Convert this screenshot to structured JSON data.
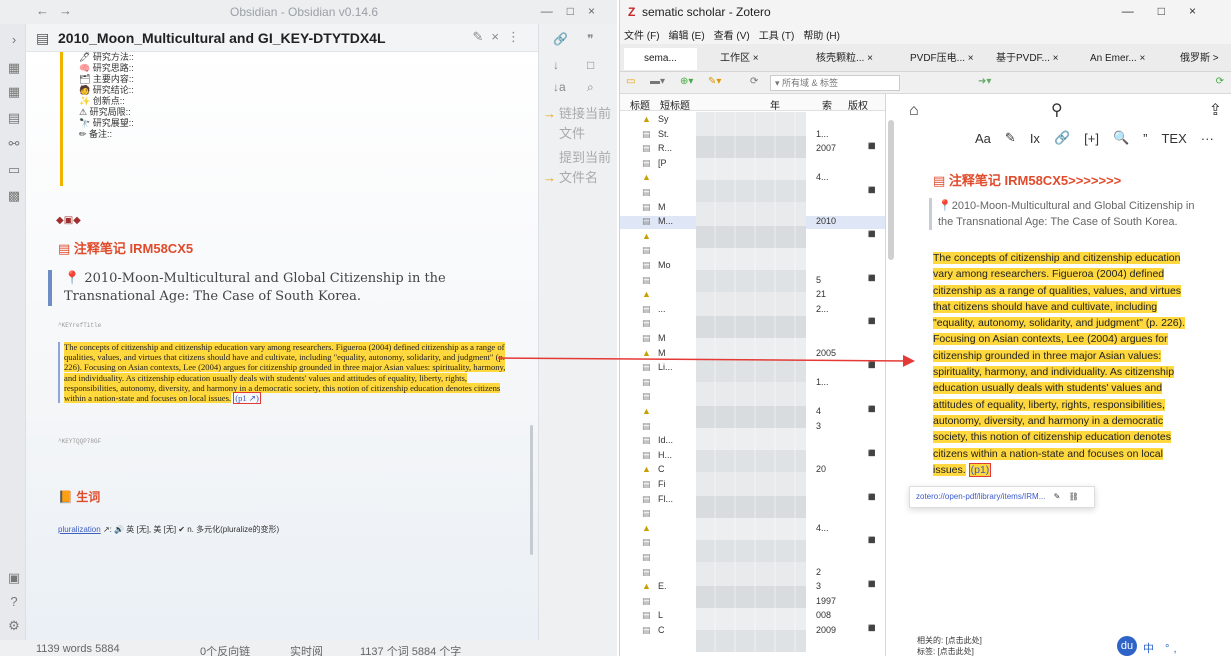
{
  "obsidian": {
    "window_title": "Obsidian - Obsidian v0.14.6",
    "tab_title": "2010_Moon_Multicultural and GI_KEY-DTYTDX4L",
    "outline_items": [
      "🖊 研究方法::",
      "🧠 研究思路::",
      "🗂 主要内容::",
      "🧑 研究结论::",
      "✨ 创新点::",
      "⚠ 研究局限::",
      "🔭 研究展望::",
      "✏ 备注::"
    ],
    "decor_text": "◆▣◆",
    "note_heading": "注释笔记 IRM58CX5",
    "citation": "2010-Moon-Multicultural and Global Citizenship in the Transnational Age: The Case of South Korea.",
    "key_tag_1": "^KEYrefTitle",
    "quote_text": "The concepts of citizenship and citizenship education vary among researchers. Figueroa (2004) defined citizenship as a range of qualities, values, and virtues that citizens should have and cultivate, including \"equality, autonomy, solidarity, and judgment\" (p. 226). Focusing on Asian contexts, Lee (2004) argues for citizenship grounded in three major Asian values: spirituality, harmony, and individuality. As citizenship education usually deals with students' values and attitudes of equality, liberty, rights, responsibilities, autonomy, diversity, and harmony in a democratic society, this notion of citizenship education denotes citizens within a nation-state and focuses on local issues.",
    "page_link": "(p1 ↗)",
    "key_tag_2": "^KEYTQQP78GF",
    "vocab_heading": "生词",
    "vocab_word": "pluralization",
    "vocab_rest": "↗: 🔊 英 [无], 美 [无] ✔ n. 多元化(pluralize的变形)",
    "side_panel": [
      "链接当前文件",
      "提到当前文件名"
    ],
    "status": {
      "words": "1139 words 5884",
      "backlinks": "0个反向链",
      "reading": "实时阅",
      "counts": "1137 个词  5884 个字"
    }
  },
  "zotero": {
    "window_title": "sematic scholar - Zotero",
    "menu": [
      "文件 (F)",
      "编辑 (E)",
      "查看 (V)",
      "工具 (T)",
      "帮助 (H)"
    ],
    "tabs": [
      "sema...",
      "工作区 ×",
      "核壳颗粒... ×",
      "PVDF压电... ×",
      "基于PVDF... ×",
      "An Emer... ×",
      "俄罗斯 >"
    ],
    "search_placeholder": "▾ 所有域 & 标签",
    "columns": [
      "标题",
      "短标题",
      "年",
      "索",
      "版权"
    ],
    "rows": [
      {
        "t": "Sy",
        "y": ""
      },
      {
        "t": "St.",
        "y": "1..."
      },
      {
        "t": "R...",
        "y": "2007"
      },
      {
        "t": "[P",
        "y": ""
      },
      {
        "t": "",
        "y": "4..."
      },
      {
        "t": "",
        "y": ""
      },
      {
        "t": "M",
        "y": ""
      },
      {
        "t": "M...",
        "y": "2010"
      },
      {
        "t": "",
        "y": ""
      },
      {
        "t": "",
        "y": ""
      },
      {
        "t": "Mo",
        "y": ""
      },
      {
        "t": "",
        "y": "5"
      },
      {
        "t": "",
        "y": "21"
      },
      {
        "t": "...",
        "y": "2..."
      },
      {
        "t": "",
        "y": ""
      },
      {
        "t": "M",
        "y": ""
      },
      {
        "t": "M",
        "y": "2005"
      },
      {
        "t": "Li...",
        "y": ""
      },
      {
        "t": "",
        "y": "1..."
      },
      {
        "t": "",
        "y": ""
      },
      {
        "t": "",
        "y": "4"
      },
      {
        "t": "",
        "y": "3"
      },
      {
        "t": "Id...",
        "y": ""
      },
      {
        "t": "H...",
        "y": ""
      },
      {
        "t": "C",
        "y": "20"
      },
      {
        "t": "Fi",
        "y": ""
      },
      {
        "t": "Fl...",
        "y": ""
      },
      {
        "t": "",
        "y": ""
      },
      {
        "t": "",
        "y": "4..."
      },
      {
        "t": "",
        "y": ""
      },
      {
        "t": "",
        "y": ""
      },
      {
        "t": "",
        "y": "2"
      },
      {
        "t": "E.",
        "y": "3"
      },
      {
        "t": "",
        "y": "1997"
      },
      {
        "t": "L",
        "y": "008"
      },
      {
        "t": "C",
        "y": "2009"
      }
    ],
    "editor_tools": [
      "Aa",
      "✎",
      "Ix",
      "🔗",
      "[+]",
      "🔍",
      "”",
      "TEX",
      "···"
    ],
    "note_heading": "注释笔记 IRM58CX5>>>>>>>",
    "citation": "2010-Moon-Multicultural and Global Citizenship in the Transnational Age: The Case of South Korea.",
    "quote_text": "The concepts of citizenship and citizenship education vary among researchers. Figueroa (2004) defined citizenship as a range of qualities, values, and virtues that citizens should have and cultivate, including \"equality, autonomy, solidarity, and judgment\" (p. 226). Focusing on Asian contexts, Lee (2004) argues for citizenship grounded in three major Asian values: spirituality, harmony, and individuality. As citizenship education usually deals with students' values and attitudes of equality, liberty, rights, responsibilities, autonomy, diversity, and harmony in a democratic society, this notion of citizenship education denotes citizens within a nation-state and focuses on local issues.",
    "page_link": "(p1)",
    "link_popup": "zotero://open-pdf/library/items/IRM...",
    "related": "相关的: [点击此处]",
    "tags_hint": "标签: [点击此处]"
  },
  "colors": {
    "highlight": "#ffd83d",
    "accent_red": "#e04b2b",
    "arrow": "#e53935"
  }
}
